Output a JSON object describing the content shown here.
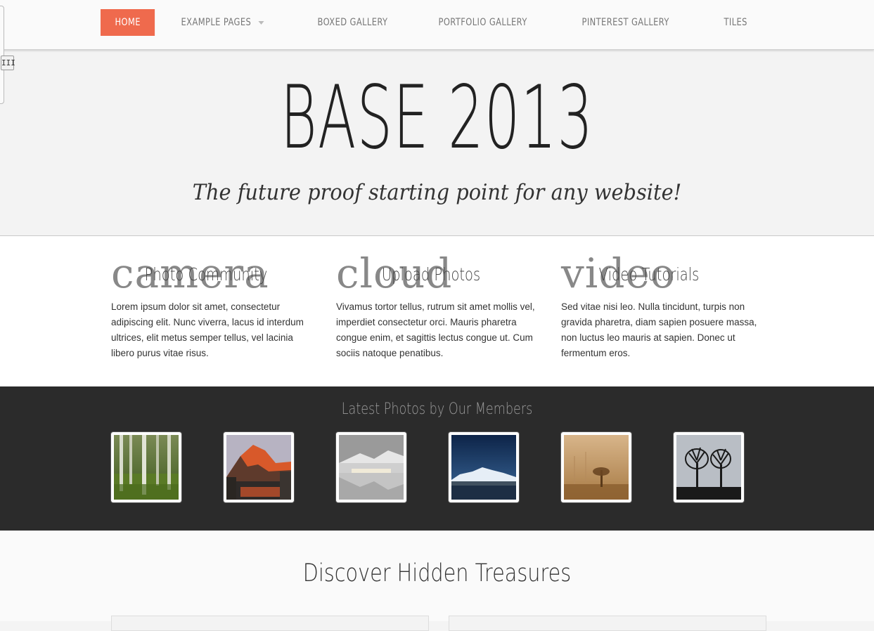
{
  "nav": {
    "items": [
      {
        "label": "HOME",
        "active": true
      },
      {
        "label": "EXAMPLE PAGES",
        "has_dropdown": true
      },
      {
        "label": "BOXED GALLERY"
      },
      {
        "label": "PORTFOLIO GALLERY"
      },
      {
        "label": "PINTEREST GALLERY"
      },
      {
        "label": "TILES"
      }
    ],
    "active_color": "#ef6a4d"
  },
  "side_handle": {
    "grip_label": "III"
  },
  "hero": {
    "title": "BASE 2013",
    "subtitle": "The future proof starting point for any website!"
  },
  "features": [
    {
      "icon_word": "camera",
      "heading": "Photo Community",
      "text": "Lorem ipsum dolor sit amet, consectetur adipiscing elit. Nunc viverra, lacus id interdum ultrices, elit metus semper tellus, vel lacinia libero purus vitae risus."
    },
    {
      "icon_word": "cloud",
      "heading": "Upload Photos",
      "text": "Vivamus tortor tellus, rutrum sit amet mollis vel, imperdiet consectetur orci. Mauris pharetra congue enim, et sagittis lectus congue ut. Cum sociis natoque penatibus."
    },
    {
      "icon_word": "video",
      "heading": "Video Tutorials",
      "text": "Sed vitae nisi leo. Nulla tincidunt, turpis non gravida pharetra, diam sapien posuere massa, non luctus leo mauris at sapien. Donec ut fermentum eros."
    }
  ],
  "photos": {
    "title": "Latest Photos by Our Members",
    "items": [
      {
        "subject": "forest-birch-trees"
      },
      {
        "subject": "sunset-mountain-river"
      },
      {
        "subject": "snowy-lake-reflection"
      },
      {
        "subject": "night-lake-mountain"
      },
      {
        "subject": "foggy-sepia-tree"
      },
      {
        "subject": "silhouette-trees"
      }
    ]
  },
  "discover": {
    "title": "Discover Hidden Treasures"
  }
}
